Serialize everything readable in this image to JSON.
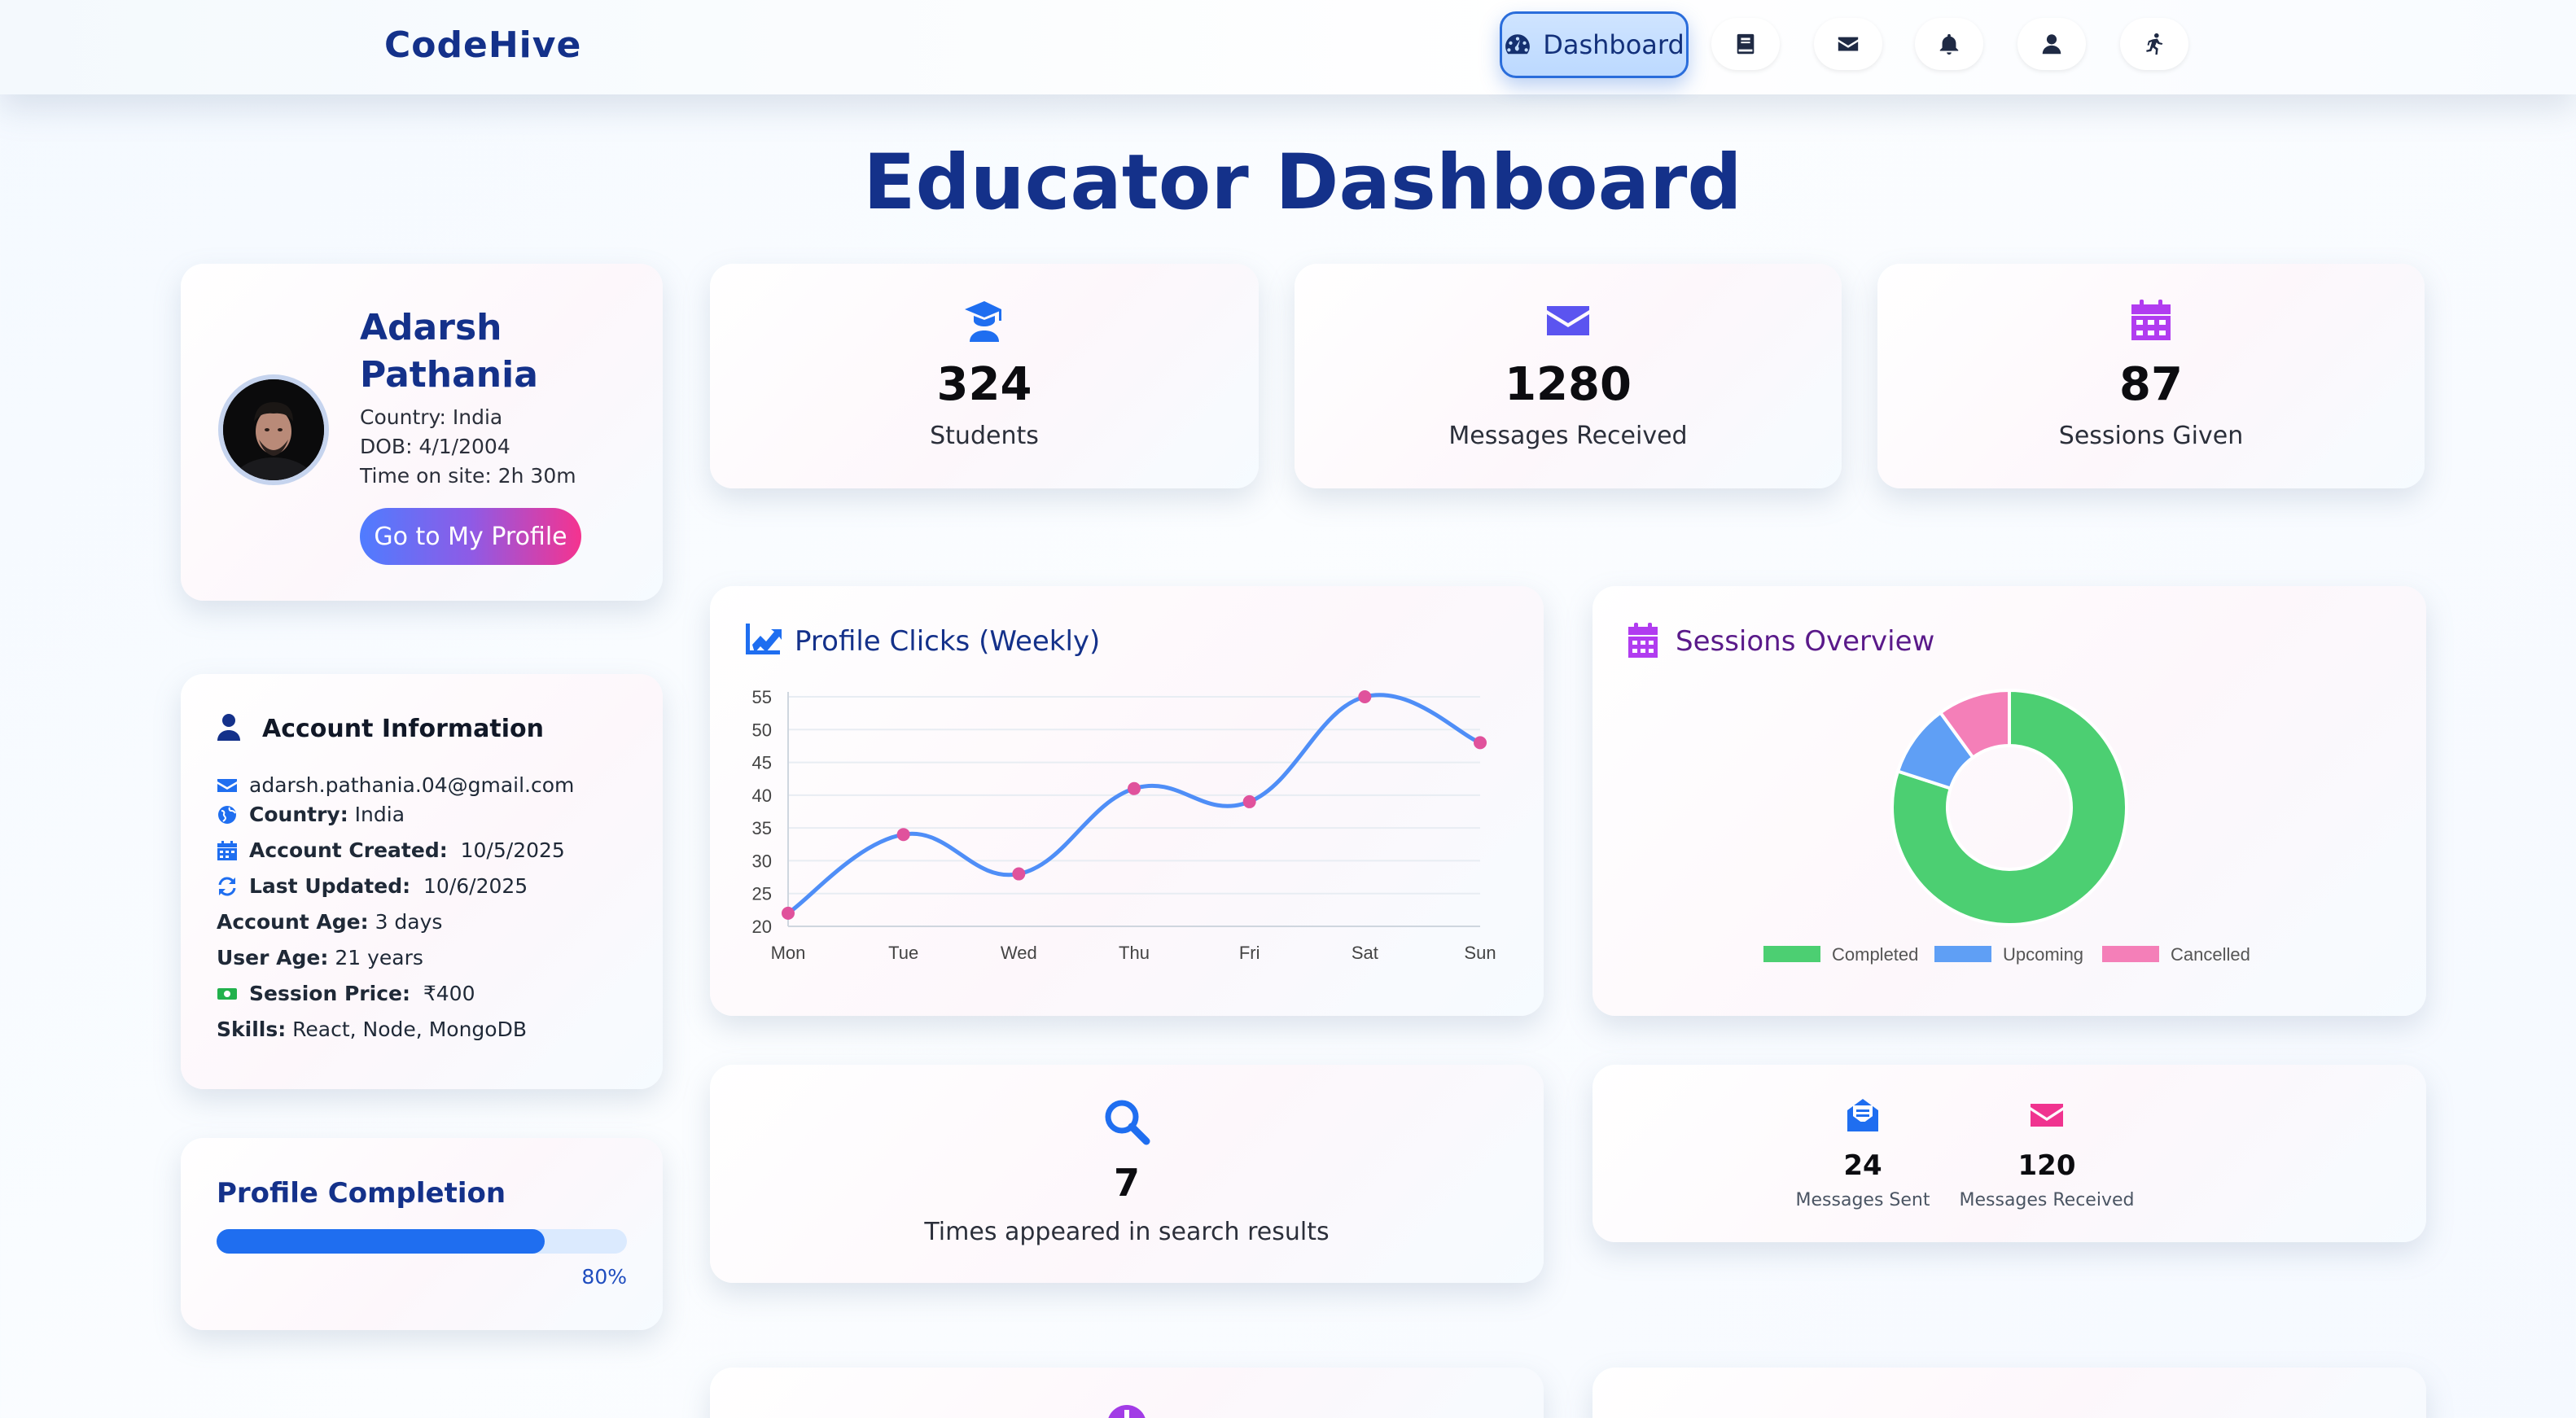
{
  "nav": {
    "brand": "CodeHive",
    "active_label": "Dashboard",
    "icons": [
      "dashboard-icon",
      "book-icon",
      "envelope-icon",
      "bell-icon",
      "user-icon",
      "running-icon"
    ]
  },
  "page": {
    "title": "Educator Dashboard"
  },
  "profile": {
    "name": "Adarsh Pathania",
    "country": "Country: India",
    "dob": "DOB: 4/1/2004",
    "time_on_site": "Time on site: 2h 30m",
    "button": "Go to My Profile"
  },
  "stats": [
    {
      "icon": "graduate-icon",
      "value": "324",
      "label": "Students",
      "color": "#1f6ef0"
    },
    {
      "icon": "envelope-icon",
      "value": "1280",
      "label": "Messages Received",
      "color": "#5b54f0"
    },
    {
      "icon": "calendar-icon",
      "value": "87",
      "label": "Sessions Given",
      "color": "#b13cf0"
    }
  ],
  "account": {
    "title": "Account Information",
    "email": "adarsh.pathania.04@gmail.com",
    "country_label": "Country:",
    "country_value": "India",
    "created_label": "Account Created:",
    "created_value": "10/5/2025",
    "updated_label": "Last Updated:",
    "updated_value": "10/6/2025",
    "account_age_label": "Account Age:",
    "account_age_value": "3 days",
    "user_age_label": "User Age:",
    "user_age_value": "21 years",
    "price_label": "Session Price:",
    "price_value": "₹400",
    "skills_label": "Skills:",
    "skills_value": "React, Node, MongoDB"
  },
  "completion": {
    "title": "Profile Completion",
    "percent_text": "80%",
    "fraction": 0.8
  },
  "search": {
    "value": "7",
    "label": "Times appeared in search results"
  },
  "messages": {
    "sent_value": "24",
    "sent_label": "Messages Sent",
    "received_value": "120",
    "received_label": "Messages Received"
  },
  "chart_data": [
    {
      "type": "line",
      "title": "Profile Clicks (Weekly)",
      "categories": [
        "Mon",
        "Tue",
        "Wed",
        "Thu",
        "Fri",
        "Sat",
        "Sun"
      ],
      "values": [
        22,
        34,
        28,
        41,
        39,
        55,
        48
      ],
      "ylim": [
        20,
        55
      ],
      "yticks": [
        20,
        25,
        30,
        35,
        40,
        45,
        50,
        55
      ],
      "line_color": "#4f8ef7",
      "point_color": "#e0529c",
      "grid": true
    },
    {
      "type": "pie",
      "title": "Sessions Overview",
      "labels": [
        "Completed",
        "Upcoming",
        "Cancelled"
      ],
      "values": [
        80,
        10,
        10
      ],
      "colors": [
        "#4ccf72",
        "#5f9ff5",
        "#f47fb8"
      ],
      "legend": "bottom"
    }
  ]
}
